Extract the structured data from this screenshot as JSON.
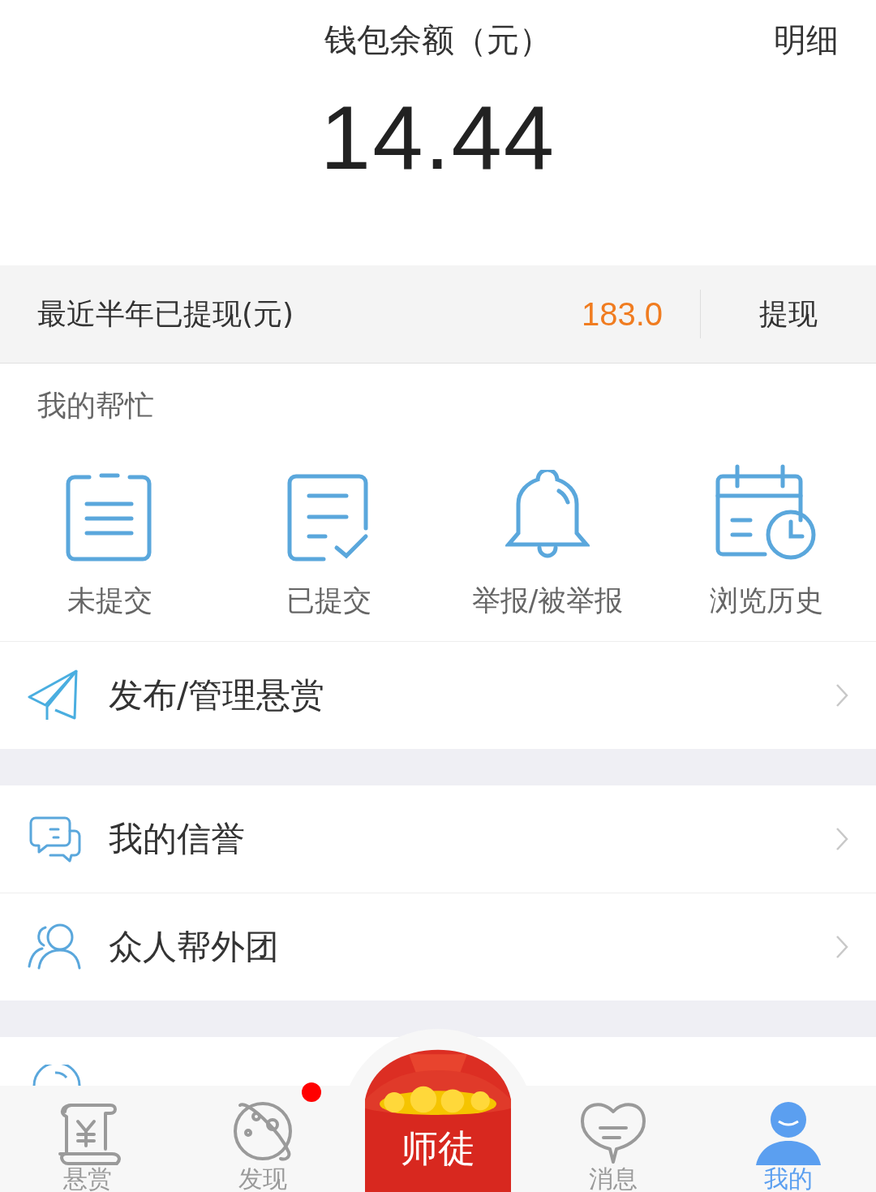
{
  "header": {
    "title": "钱包余额（元）",
    "detail_link": "明细",
    "balance": "14.44"
  },
  "withdraw_bar": {
    "label": "最近半年已提现(元)",
    "amount": "183.0",
    "button": "提现"
  },
  "help_section": {
    "title": "我的帮忙",
    "items": [
      {
        "label": "未提交",
        "kind": "clipboard"
      },
      {
        "label": "已提交",
        "kind": "checked-doc"
      },
      {
        "label": "举报/被举报",
        "kind": "bell"
      },
      {
        "label": "浏览历史",
        "kind": "calendar"
      }
    ]
  },
  "menu_groups": [
    [
      {
        "label": "发布/管理悬赏",
        "kind": "send"
      }
    ],
    [
      {
        "label": "我的信誉",
        "kind": "chat"
      },
      {
        "label": "众人帮外团",
        "kind": "people"
      }
    ],
    [
      {
        "kind": "help"
      }
    ]
  ],
  "bottom_nav": {
    "items": [
      {
        "label": "悬赏",
        "kind": "scroll",
        "selected": false,
        "badge": false
      },
      {
        "label": "发现",
        "kind": "planet",
        "selected": false,
        "badge": true
      },
      {
        "label": "师徒",
        "kind": "envelope",
        "selected": false,
        "badge": false
      },
      {
        "label": "消息",
        "kind": "message",
        "selected": false,
        "badge": false
      },
      {
        "label": "我的",
        "kind": "user",
        "selected": true,
        "badge": false
      }
    ]
  }
}
